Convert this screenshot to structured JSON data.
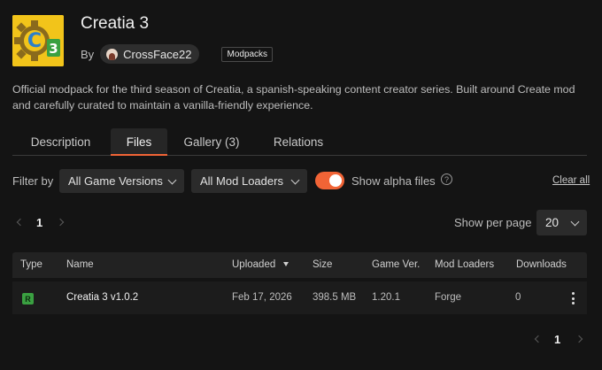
{
  "header": {
    "logo_letter": "C",
    "logo_badge": "3",
    "title": "Creatia 3",
    "by_label": "By",
    "author": "CrossFace22",
    "tag": "Modpacks"
  },
  "description": "Official modpack for the third season of Creatia, a spanish-speaking content creator series. Built around Create mod and carefully curated to maintain a vanilla-friendly experience.",
  "tabs": [
    {
      "label": "Description",
      "active": false
    },
    {
      "label": "Files",
      "active": true
    },
    {
      "label": "Gallery (3)",
      "active": false
    },
    {
      "label": "Relations",
      "active": false
    }
  ],
  "filters": {
    "label": "Filter by",
    "game_versions": "All Game Versions",
    "mod_loaders": "All Mod Loaders",
    "alpha_toggle_on": true,
    "alpha_label": "Show alpha files",
    "help_glyph": "?",
    "clear_all": "Clear all"
  },
  "pagination": {
    "current_page": "1",
    "per_page_label": "Show per page",
    "per_page_value": "20"
  },
  "table": {
    "columns": [
      "Type",
      "Name",
      "Uploaded",
      "Size",
      "Game Ver.",
      "Mod Loaders",
      "Downloads"
    ],
    "sorted_column": "Uploaded",
    "rows": [
      {
        "type": "R",
        "name": "Creatia 3 v1.0.2",
        "uploaded": "Feb 17, 2026",
        "size": "398.5 MB",
        "game_version": "1.20.1",
        "mod_loader": "Forge",
        "downloads": "0"
      }
    ]
  },
  "colors": {
    "accent": "#f16436",
    "background": "#141414",
    "release_badge": "#3aa041",
    "logo_yellow": "#f2c41a"
  },
  "icons": [
    "gear-logo-icon",
    "author-avatar-icon",
    "chevron-down-icon",
    "help-circle-icon",
    "chevron-left-icon",
    "chevron-right-icon",
    "sort-desc-icon",
    "kebab-menu-icon"
  ]
}
